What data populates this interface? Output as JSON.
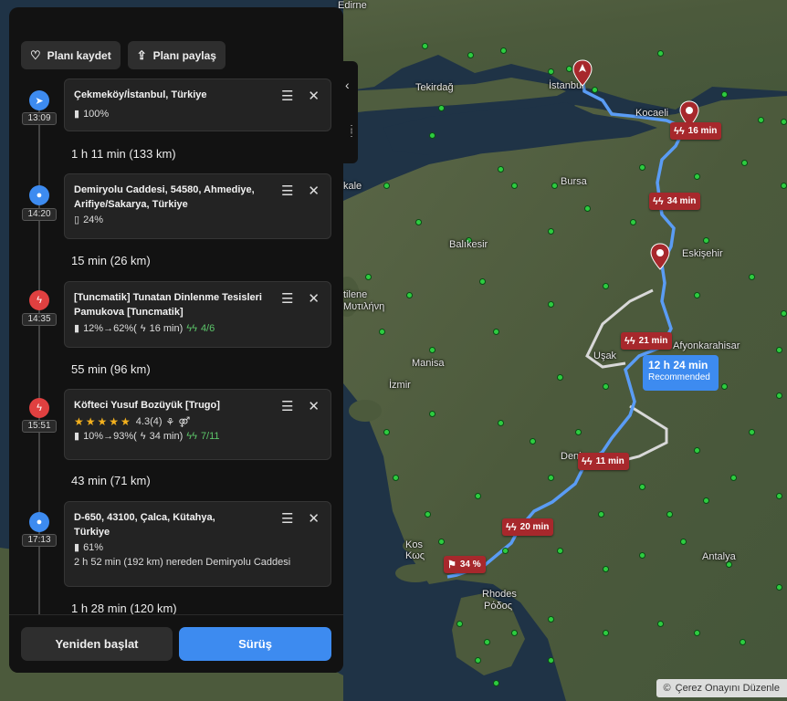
{
  "map": {
    "labels": [
      "Edirne",
      "Tekirdağ",
      "İstanbul",
      "Kocaeli",
      "Bursa",
      "Balıkesir",
      "Eskişehir",
      "Uşak",
      "Afyonkarahisar",
      "Manisa",
      "İzmir",
      "Deni",
      "Kos",
      "Κως",
      "Rhodes",
      "Ρόδος",
      "Antalya",
      "Μυτιλήνη",
      "tilene",
      "kale",
      "i",
      "ıı",
      "De"
    ],
    "badges": [
      "16 min",
      "34 min",
      "21 min",
      "11 min",
      "20 min",
      "34 %"
    ],
    "route_info": {
      "duration": "12 h 24 min",
      "tag": "Recommended"
    },
    "cookie_text": "Çerez Onayını Düzenle",
    "cookie_icon": "copyright-icon"
  },
  "panel": {
    "save_label": "Planı kaydet",
    "share_label": "Planı paylaş",
    "stops": [
      {
        "time": "13:09",
        "icon": "navigation-arrow-icon",
        "title": "Çekmeköy/İstanbul, Türkiye",
        "battery": "100%"
      },
      {
        "time": "14:20",
        "icon": "location-pin-icon",
        "title": "Demiryolu Caddesi, 54580, Ahmediye, Arifiye/Sakarya, Türkiye",
        "battery": "24%"
      },
      {
        "time": "14:35",
        "icon": "charger-icon",
        "title": "[Tuncmatik] Tunatan Dinlenme Tesisleri Pamukova [Tuncmatik]",
        "charge": "12%→62%(",
        "charge_time": "16 min)",
        "ports": "4/6"
      },
      {
        "time": "15:51",
        "icon": "charger-icon",
        "title": "Köfteci Yusuf Bozüyük [Trugo]",
        "rating": "4.3(4)",
        "charge": "10%→93%(",
        "charge_time": "34 min)",
        "ports": "7/11"
      },
      {
        "time": "17:13",
        "icon": "location-pin-icon",
        "title": "D-650, 43100, Çalca, Kütahya, Türkiye",
        "battery": "61%",
        "note": "2 h 52 min (192 km) nereden Demiryolu Caddesi"
      }
    ],
    "legs": [
      "1 h 11 min (133 km)",
      "15 min (26 km)",
      "55 min (96 km)",
      "43 min (71 km)",
      "1 h 28 min (120 km)"
    ],
    "restart_label": "Yeniden başlat",
    "drive_label": "Sürüş"
  },
  "colors": {
    "accent": "#3d8bf0",
    "route": "#5a9cf5",
    "charger": "#a7282c",
    "panel": "#121212"
  }
}
